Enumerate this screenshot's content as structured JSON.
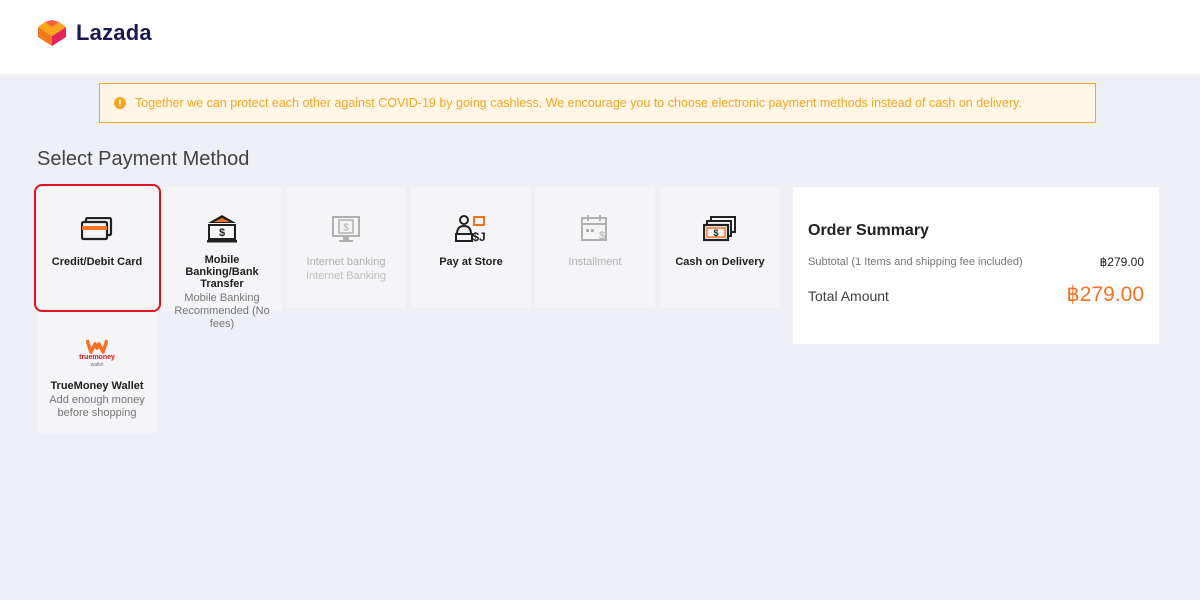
{
  "header": {
    "logo_text": "Lazada"
  },
  "notice": {
    "text": "Together we can protect each other against COVID-19 by going cashless. We encourage you to choose electronic payment methods instead of cash on delivery."
  },
  "page_title": "Select Payment Method",
  "payment_methods": [
    {
      "name": "Credit/Debit Card",
      "sub": "",
      "icon": "credit-card-icon",
      "disabled": false,
      "selected": true
    },
    {
      "name": "Mobile Banking/Bank Transfer",
      "sub": "Mobile Banking Recommended (No fees)",
      "icon": "bank-icon",
      "disabled": false
    },
    {
      "name": "Internet banking",
      "sub": "Internet Banking",
      "icon": "monitor-dollar-icon",
      "disabled": true
    },
    {
      "name": "Pay at Store",
      "sub": "",
      "icon": "store-payment-icon",
      "disabled": false
    },
    {
      "name": "Installment",
      "sub": "",
      "icon": "calendar-dollar-icon",
      "disabled": true
    },
    {
      "name": "Cash on Delivery",
      "sub": "",
      "icon": "cash-icon",
      "disabled": false
    },
    {
      "name": "TrueMoney Wallet",
      "sub": "Add enough money before shopping",
      "icon": "truemoney-logo-icon",
      "logo_text": "truemoney",
      "logo_sub": "wallet",
      "disabled": false
    }
  ],
  "order_summary": {
    "title": "Order Summary",
    "subtotal_label": "Subtotal (1 Items and shipping fee included)",
    "subtotal_value": "฿279.00",
    "total_label": "Total Amount",
    "total_value": "฿279.00"
  },
  "colors": {
    "accent": "#f57224",
    "notice": "#f5a623",
    "highlight": "#e0141c"
  }
}
